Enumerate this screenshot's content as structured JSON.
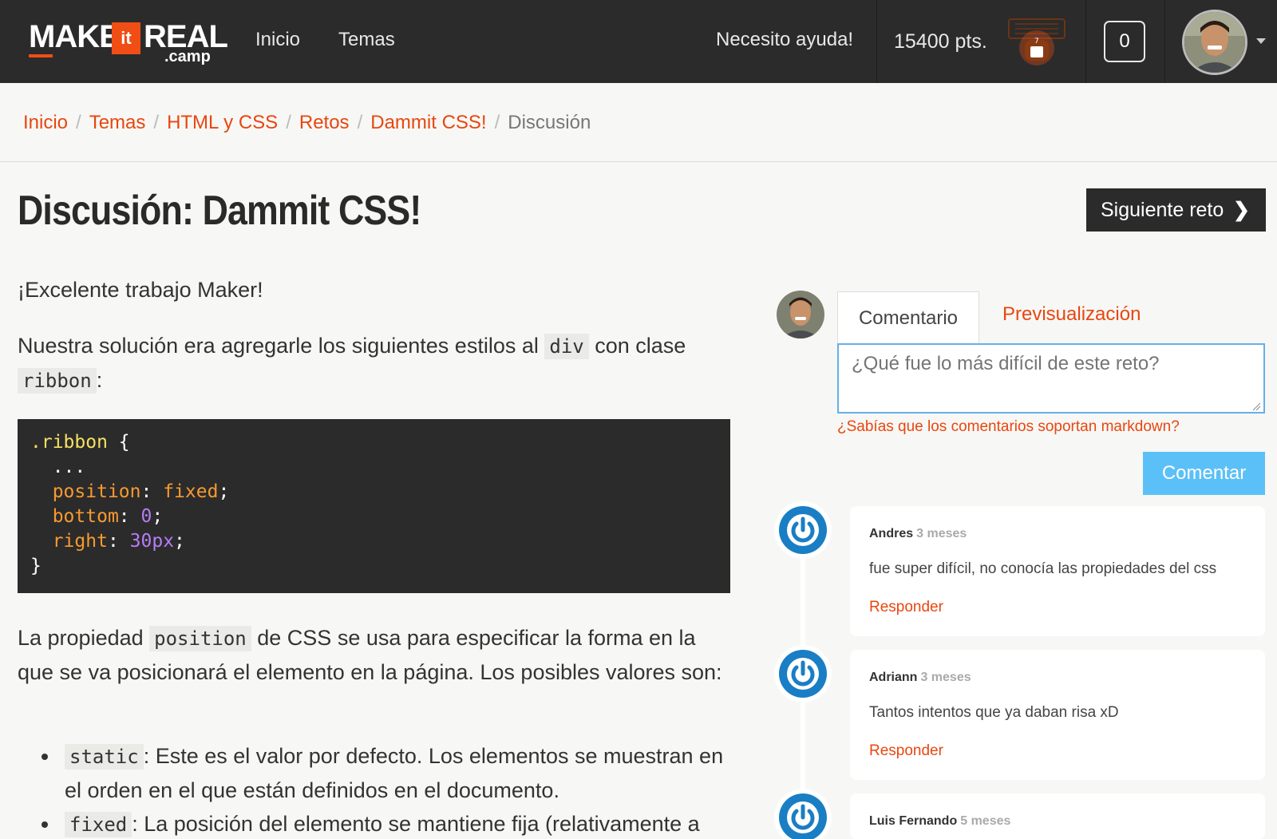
{
  "header": {
    "logo": {
      "make": "MAKE",
      "it": "it",
      "real": "REAL",
      "camp": ".camp"
    },
    "nav": [
      {
        "label": "Inicio"
      },
      {
        "label": "Temas"
      }
    ],
    "help": "Necesito ayuda!",
    "points": "15400 pts.",
    "badge_count": "7",
    "notifications": "0",
    "accent": "#f04e14"
  },
  "breadcrumb": {
    "items": [
      "Inicio",
      "Temas",
      "HTML y CSS",
      "Retos",
      "Dammit CSS!"
    ],
    "current": "Discusión"
  },
  "page": {
    "title": "Discusión: Dammit CSS!",
    "next_button": "Siguiente reto",
    "greeting": "¡Excelente trabajo Maker!",
    "intro_a": "Nuestra solución era agregarle los siguientes estilos al",
    "intro_code1": "div",
    "intro_b": "con clase",
    "intro_code2": "ribbon",
    "intro_c": ":",
    "code": {
      "selector": ".ribbon",
      "open": "{",
      "ellipsis": "...",
      "lines": [
        {
          "prop": "position",
          "value": "fixed",
          "value_type": "keyword"
        },
        {
          "prop": "bottom",
          "value": "0",
          "value_type": "number"
        },
        {
          "prop": "right",
          "value": "30px",
          "value_type": "number"
        }
      ],
      "close": "}"
    },
    "explain_a": "La propiedad",
    "explain_code": "position",
    "explain_b": "de CSS se usa para especificar la forma en la que se va posicionará el elemento en la página. Los posibles valores son:",
    "list": [
      {
        "code": "static",
        "text": ": Este es el valor por defecto. Los elementos se muestran en el orden en el que están definidos en el documento."
      },
      {
        "code": "fixed",
        "text": ": La posición del elemento se mantiene fija (relativamente a"
      }
    ]
  },
  "comments": {
    "tabs": {
      "write": "Comentario",
      "preview": "Previsualización"
    },
    "placeholder": "¿Qué fue lo más difícil de este reto?",
    "markdown_hint": "¿Sabías que los comentarios soportan markdown?",
    "submit": "Comentar",
    "reply_label": "Responder",
    "items": [
      {
        "author": "Andres",
        "ago": "3 meses",
        "text": "fue super difícil, no conocía las propiedades del css"
      },
      {
        "author": "Adriann",
        "ago": "3 meses",
        "text": "Tantos intentos que ya daban risa xD"
      },
      {
        "author": "Luis Fernando",
        "ago": "5 meses",
        "text": ""
      }
    ]
  }
}
